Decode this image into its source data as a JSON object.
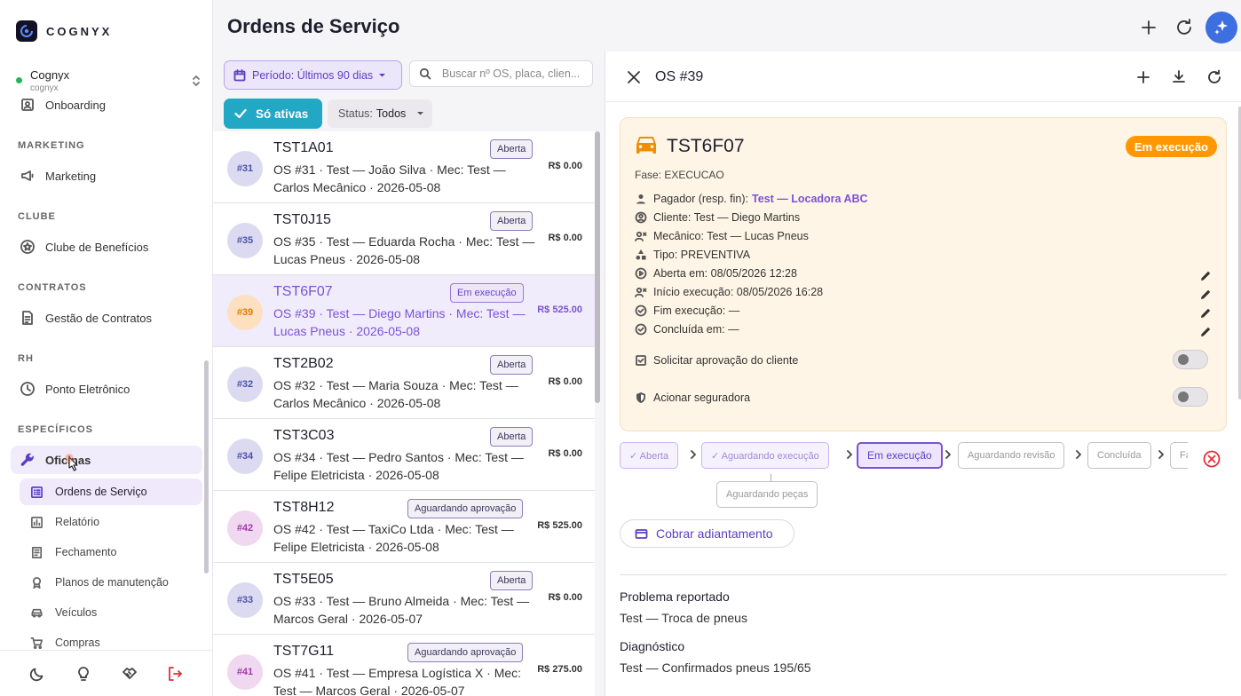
{
  "brand": {
    "name": "COGNYX"
  },
  "org": {
    "name": "Cognyx",
    "sub": "cognyx"
  },
  "sidebar": {
    "items": {
      "onboarding": "Onboarding",
      "marketing_label": "MARKETING",
      "marketing": "Marketing",
      "clube_label": "CLUBE",
      "clube": "Clube de Benefícios",
      "contratos_label": "CONTRATOS",
      "contratos": "Gestão de Contratos",
      "rh_label": "RH",
      "ponto": "Ponto Eletrônico",
      "especificos_label": "ESPECÍFICOS",
      "oficinas": "Oficinas",
      "ordens": "Ordens de Serviço",
      "relatorio": "Relatório",
      "fechamento": "Fechamento",
      "planos": "Planos de manutenção",
      "veiculos": "Veículos",
      "compras": "Compras"
    }
  },
  "page": {
    "title": "Ordens de Serviço"
  },
  "filters": {
    "period": "Período: Últimos 90 dias",
    "search_placeholder": "Buscar nº OS, placa, clien...",
    "only_active": "Só ativas",
    "status_label": "Status:",
    "status_value": "Todos"
  },
  "orders": [
    {
      "num": "#31",
      "plate": "TST1A01",
      "desc": "OS #31 · Test — João Silva · Mec: Test — Carlos Mecânico · 2026-05-08",
      "badge": "Aberta",
      "price": "R$ 0.00"
    },
    {
      "num": "#35",
      "plate": "TST0J15",
      "desc": "OS #35 · Test — Eduarda Rocha · Mec: Test — Lucas Pneus · 2026-05-08",
      "badge": "Aberta",
      "price": "R$ 0.00"
    },
    {
      "num": "#39",
      "plate": "TST6F07",
      "desc": "OS #39 · Test — Diego Martins · Mec: Test — Lucas Pneus · 2026-05-08",
      "badge": "Em execução",
      "price": "R$ 525.00"
    },
    {
      "num": "#32",
      "plate": "TST2B02",
      "desc": "OS #32 · Test — Maria Souza · Mec: Test — Carlos Mecânico · 2026-05-08",
      "badge": "Aberta",
      "price": "R$ 0.00"
    },
    {
      "num": "#34",
      "plate": "TST3C03",
      "desc": "OS #34 · Test — Pedro Santos · Mec: Test — Felipe Eletricista · 2026-05-08",
      "badge": "Aberta",
      "price": "R$ 0.00"
    },
    {
      "num": "#42",
      "plate": "TST8H12",
      "desc": "OS #42 · Test — TaxiCo Ltda · Mec: Test — Felipe Eletricista · 2026-05-08",
      "badge": "Aguardando aprovação",
      "price": "R$ 525.00"
    },
    {
      "num": "#33",
      "plate": "TST5E05",
      "desc": "OS #33 · Test — Bruno Almeida · Mec: Test — Marcos Geral · 2026-05-07",
      "badge": "Aberta",
      "price": "R$ 0.00"
    },
    {
      "num": "#41",
      "plate": "TST7G11",
      "desc": "OS #41 · Test — Empresa Logística X · Mec: Test — Marcos Geral · 2026-05-07",
      "badge": "Aguardando aprovação",
      "price": "R$ 275.00"
    }
  ],
  "detail": {
    "title": "OS #39",
    "plate": "TST6F07",
    "status": "Em execução",
    "fase": "Fase: EXECUCAO",
    "pagador_label": "Pagador (resp. fin):",
    "pagador_value": "Test — Locadora ABC",
    "cliente": "Cliente: Test — Diego Martins",
    "mecanico": "Mecânico: Test — Lucas Pneus",
    "tipo": "Tipo: PREVENTIVA",
    "aberta": "Aberta em: 08/05/2026 12:28",
    "inicio": "Início execução: 08/05/2026 16:28",
    "fim": "Fim execução: —",
    "concluida": "Concluída em: —",
    "aprov": "Solicitar aprovação do cliente",
    "seguradora": "Acionar seguradora",
    "steps": {
      "aberta": "✓ Aberta",
      "aguardando_exec": "✓ Aguardando execução",
      "em_execucao": "Em execução",
      "aguardando_revisao": "Aguardando revisão",
      "concluida": "Concluída",
      "fa": "Fa",
      "aguardando_pecas": "Aguardando peças"
    },
    "cobrar": "Cobrar adiantamento",
    "problema_h": "Problema reportado",
    "problema": "Test — Troca de pneus",
    "diag_h": "Diagnóstico",
    "diag": "Test — Confirmados pneus 195/65"
  },
  "colors": {
    "accent": "#7a52d6",
    "active_filter": "#22a7c5",
    "status_exec": "#ff9800",
    "card_bg": "#fff5e6"
  }
}
